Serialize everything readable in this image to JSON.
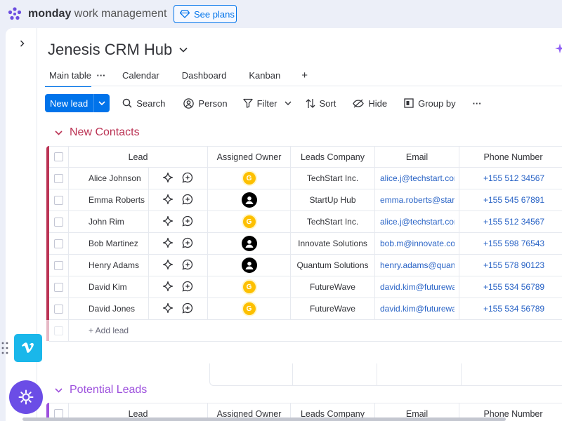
{
  "topbar": {
    "brand_bold": "monday",
    "brand_rest": "work management",
    "see_plans_label": "See plans"
  },
  "board": {
    "title": "Jenesis CRM Hub"
  },
  "tabs": [
    {
      "label": "Main table",
      "active": true
    },
    {
      "label": "Calendar"
    },
    {
      "label": "Dashboard"
    },
    {
      "label": "Kanban"
    }
  ],
  "tabs_more": "···",
  "tabs_add": "+",
  "toolbar": {
    "new_label": "New lead",
    "search": "Search",
    "person": "Person",
    "filter": "Filter",
    "sort": "Sort",
    "hide": "Hide",
    "group_by": "Group by",
    "more": "···"
  },
  "columns": {
    "lead": "Lead",
    "owner": "Assigned Owner",
    "company": "Leads Company",
    "email": "Email",
    "phone": "Phone Number"
  },
  "groups": [
    {
      "name": "New Contacts",
      "color": "#bb3354",
      "add_label": "+ Add lead",
      "rows": [
        {
          "lead": "Alice Johnson",
          "owner": "G",
          "company": "TechStart Inc.",
          "email": "alice.j@techstart.com",
          "phone": "+155 512 34567"
        },
        {
          "lead": "Emma Roberts",
          "owner": "person",
          "company": "StartUp Hub",
          "email": "emma.roberts@startuphub.com",
          "phone": "+155 545 67891"
        },
        {
          "lead": "John Rim",
          "owner": "G",
          "company": "TechStart Inc.",
          "email": "alice.j@techstart.com",
          "phone": "+155 512 34567"
        },
        {
          "lead": "Bob Martinez",
          "owner": "person",
          "company": "Innovate Solutions",
          "email": "bob.m@innovate.com",
          "phone": "+155 598 76543"
        },
        {
          "lead": "Henry Adams",
          "owner": "person",
          "company": "Quantum Solutions",
          "email": "henry.adams@quantum.com",
          "phone": "+155 578 90123"
        },
        {
          "lead": "David Kim",
          "owner": "G",
          "company": "FutureWave",
          "email": "david.kim@futurewave.com",
          "phone": "+155 534 56789"
        },
        {
          "lead": "David Jones",
          "owner": "G",
          "company": "FutureWave",
          "email": "david.kim@futurewave.com",
          "phone": "+155 534 56789"
        }
      ]
    },
    {
      "name": "Potential Leads",
      "color": "#9d50dd",
      "rows": []
    }
  ]
}
